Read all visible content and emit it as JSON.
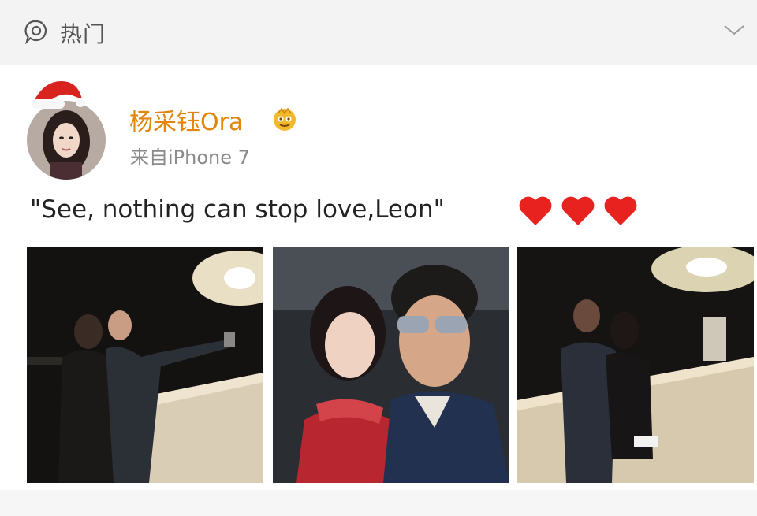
{
  "header": {
    "label": "热门",
    "icon": "hot-topic-icon",
    "chevron": "chevron-down-icon"
  },
  "post": {
    "username": "杨采钰Ora",
    "source": "来自iPhone 7",
    "text": "\"See, nothing can stop love,Leon\"",
    "heart_count": 3,
    "heart_color": "#e8231f",
    "username_color": "#e2860b",
    "photos": [
      "couple-selfie-night-bridge-photo",
      "couple-selfie-closeup-photo",
      "couple-embrace-night-bridge-photo"
    ]
  }
}
